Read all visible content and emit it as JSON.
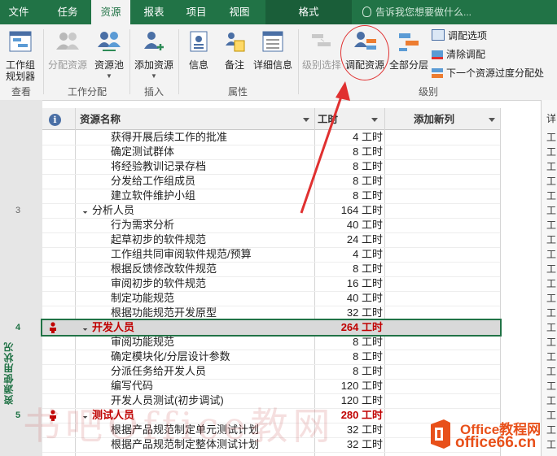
{
  "tabs": [
    {
      "label": "文件"
    },
    {
      "label": "任务"
    },
    {
      "label": "资源"
    },
    {
      "label": "报表"
    },
    {
      "label": "项目"
    },
    {
      "label": "视图"
    },
    {
      "label": "格式"
    }
  ],
  "tell_me": {
    "placeholder": "告诉我您想要做什么..."
  },
  "ribbon": {
    "view_btn": "工作组\n规划器",
    "view_group": "查看",
    "assign_btn": "分配资源",
    "pool_btn": "资源池",
    "assign_group": "工作分配",
    "add_btn": "添加资源",
    "insert_group": "插入",
    "info_btn": "信息",
    "notes_btn": "备注",
    "details_btn": "详细信息",
    "props_group": "属性",
    "level_sel_btn": "级别选择",
    "level_res_btn": "调配资源",
    "level_all_btn": "全部分层",
    "level_opts": "调配选项",
    "clear_level": "清除调配",
    "next_overalloc": "下一个资源过度分配处",
    "level_group": "级别"
  },
  "grid": {
    "col_name": "资源名称",
    "col_work": "工时",
    "col_add": "添加新列",
    "side_label": "资源使用状况",
    "right_header": "详",
    "right_cell": "工",
    "rows": [
      {
        "id": "",
        "name": "获得开展后续工作的批准",
        "work": "4 工时",
        "type": "task"
      },
      {
        "id": "",
        "name": "确定测试群体",
        "work": "8 工时",
        "type": "task"
      },
      {
        "id": "",
        "name": "将经验教训记录存档",
        "work": "8 工时",
        "type": "task"
      },
      {
        "id": "",
        "name": "分发给工作组成员",
        "work": "8 工时",
        "type": "task"
      },
      {
        "id": "",
        "name": "建立软件维护小组",
        "work": "8 工时",
        "type": "task"
      },
      {
        "id": "3",
        "name": "分析人员",
        "work": "164 工时",
        "type": "resource"
      },
      {
        "id": "",
        "name": "行为需求分析",
        "work": "40 工时",
        "type": "task"
      },
      {
        "id": "",
        "name": "起草初步的软件规范",
        "work": "24 工时",
        "type": "task"
      },
      {
        "id": "",
        "name": "工作组共同审阅软件规范/预算",
        "work": "4 工时",
        "type": "task"
      },
      {
        "id": "",
        "name": "根据反馈修改软件规范",
        "work": "8 工时",
        "type": "task"
      },
      {
        "id": "",
        "name": "审阅初步的软件规范",
        "work": "16 工时",
        "type": "task"
      },
      {
        "id": "",
        "name": "制定功能规范",
        "work": "40 工时",
        "type": "task"
      },
      {
        "id": "",
        "name": "根据功能规范开发原型",
        "work": "32 工时",
        "type": "task"
      },
      {
        "id": "4",
        "name": "开发人员",
        "work": "264 工时",
        "type": "over-selected"
      },
      {
        "id": "",
        "name": "审阅功能规范",
        "work": "8 工时",
        "type": "task"
      },
      {
        "id": "",
        "name": "确定模块化/分层设计参数",
        "work": "8 工时",
        "type": "task"
      },
      {
        "id": "",
        "name": "分派任务给开发人员",
        "work": "8 工时",
        "type": "task"
      },
      {
        "id": "",
        "name": "编写代码",
        "work": "120 工时",
        "type": "task"
      },
      {
        "id": "",
        "name": "开发人员测试(初步调试)",
        "work": "120 工时",
        "type": "task"
      },
      {
        "id": "5",
        "name": "测试人员",
        "work": "280 工时",
        "type": "over"
      },
      {
        "id": "",
        "name": "根据产品规范制定单元测试计划",
        "work": "32 工时",
        "type": "task"
      },
      {
        "id": "",
        "name": "根据产品规范制定整体测试计划",
        "work": "32 工时",
        "type": "task"
      }
    ]
  },
  "watermark": "书吧Office教网",
  "logo": {
    "line1": "Office教程网",
    "line2": "office66.cn"
  },
  "colors": {
    "brand": "#217346",
    "overalloc": "#c00000",
    "annotation": "#e03030",
    "logo": "#e8501a"
  }
}
